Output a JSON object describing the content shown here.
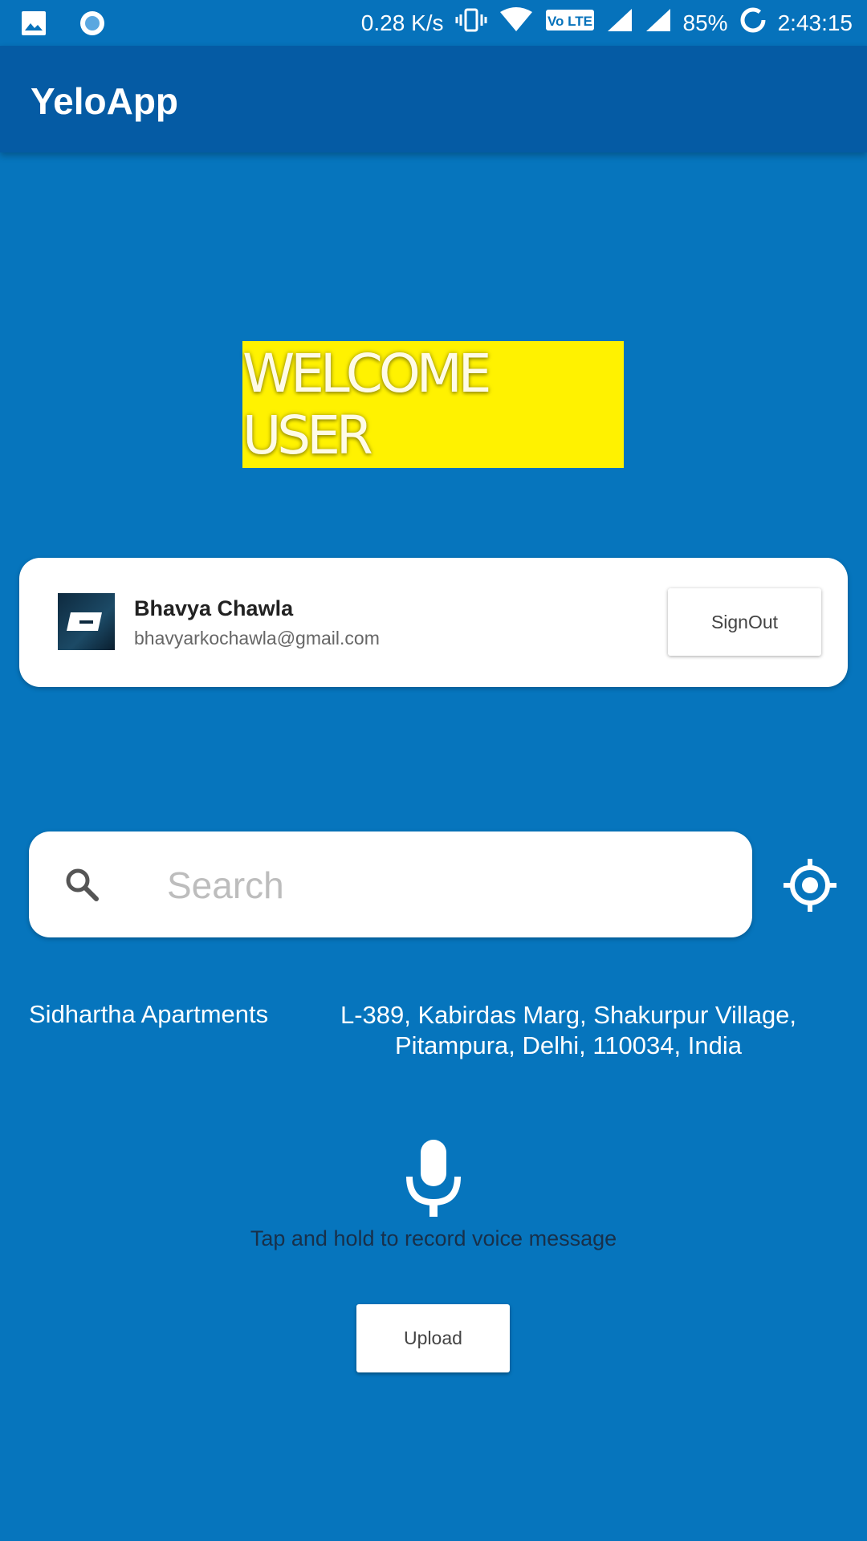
{
  "status_bar": {
    "network_speed": "0.28 K/s",
    "volte_label": "Vo LTE",
    "battery": "85%",
    "time": "2:43:15"
  },
  "app_bar": {
    "title": "YeloApp"
  },
  "banner": {
    "text": "WELCOME USER"
  },
  "profile": {
    "name": "Bhavya Chawla",
    "email": "bhavyarkochawla@gmail.com",
    "signout_label": "SignOut"
  },
  "search": {
    "placeholder": "Search",
    "value": ""
  },
  "location": {
    "place_name": "Sidhartha Apartments",
    "address": "L-389, Kabirdas Marg, Shakurpur Village, Pitampura, Delhi, 110034, India"
  },
  "voice": {
    "hint": "Tap and hold to record voice message"
  },
  "upload": {
    "label": "Upload"
  },
  "colors": {
    "background": "#0675bd",
    "app_bar": "#055ba4",
    "banner": "#fff200"
  }
}
